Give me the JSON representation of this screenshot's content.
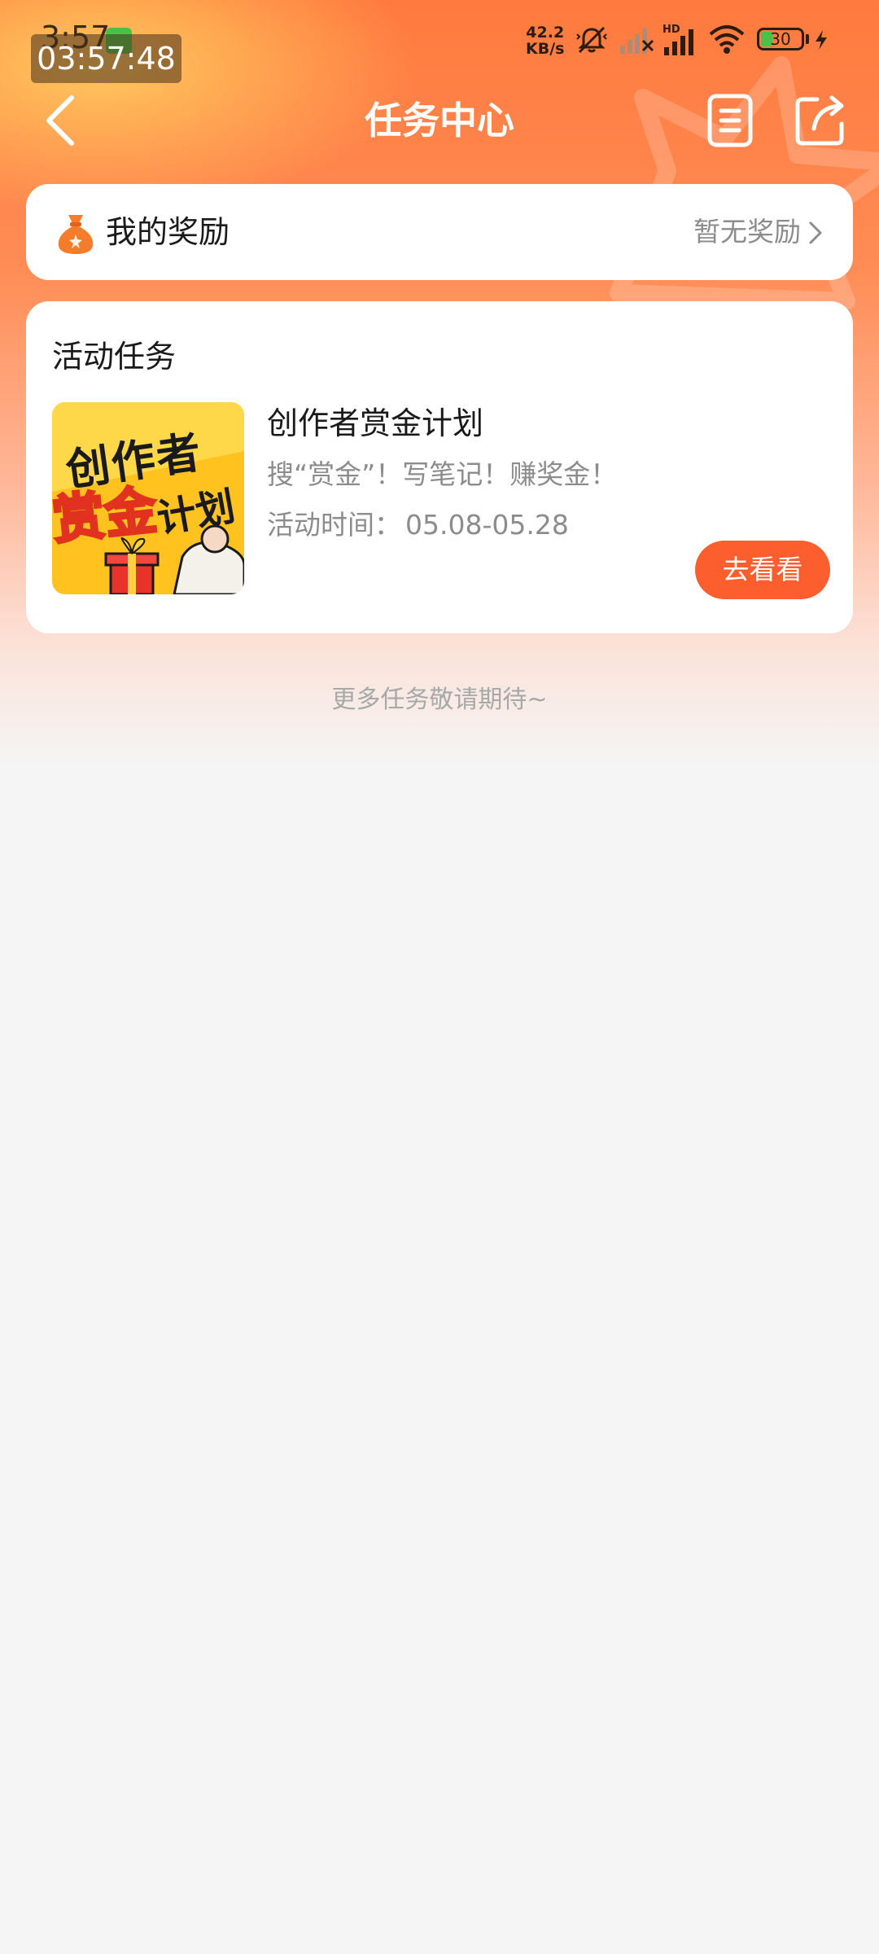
{
  "status_bar": {
    "time": "3:57",
    "clock_overlay": "03:57:48",
    "net_speed_value": "42.2",
    "net_speed_unit": "KB/s",
    "battery_level": "30",
    "hd_label": "HD",
    "icons": [
      "mute-vibrate-icon",
      "signal-weak-icon",
      "signal-hd-icon",
      "wifi-icon",
      "battery-icon",
      "charging-icon"
    ]
  },
  "nav": {
    "title": "任务中心",
    "icons": [
      "back-arrow-icon",
      "notes-icon",
      "share-icon"
    ]
  },
  "reward": {
    "title": "我的奖励",
    "status": "暂无奖励",
    "icon": "money-bag-icon"
  },
  "activity": {
    "section_title": "活动任务",
    "task": {
      "thumb_lines": [
        "创作者",
        "赏金",
        "计划"
      ],
      "title": "创作者赏金计划",
      "description": "搜“赏金”！写笔记！赚奖金！",
      "time_label": "活动时间：",
      "time_value": "05.08-05.28",
      "button_label": "去看看"
    }
  },
  "footer": {
    "note": "更多任务敬请期待~"
  },
  "colors": {
    "accent": "#fd5e2e",
    "header_top": "#ff7a3e",
    "muted_text": "#8c8c8c",
    "background": "#f5f5f5"
  }
}
